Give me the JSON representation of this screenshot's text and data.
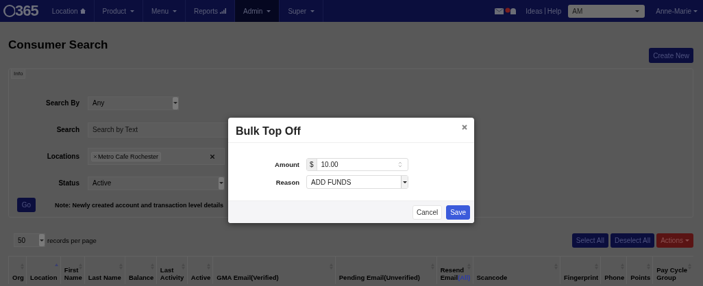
{
  "navbar": {
    "logo": "365",
    "items": [
      {
        "label": "Location",
        "kind": "home",
        "selected": false
      },
      {
        "label": "Product",
        "kind": "dropdown",
        "selected": false
      },
      {
        "label": "Menu",
        "kind": "dropdown",
        "selected": false
      },
      {
        "label": "Reports",
        "kind": "signal",
        "selected": false
      },
      {
        "label": "Admin",
        "kind": "dropdown",
        "selected": true
      },
      {
        "label": "Super",
        "kind": "dropdown",
        "selected": false
      }
    ],
    "links": [
      "Ideas",
      "Help"
    ],
    "org_select": {
      "value": "AM"
    },
    "user": "Anne-Marie"
  },
  "page": {
    "title": "Consumer Search",
    "create_button": "Create New"
  },
  "info_panel": {
    "legend": "Info",
    "fields": [
      {
        "kind": "select",
        "label": "Search By",
        "value": "Any"
      },
      {
        "kind": "text",
        "label": "Search",
        "placeholder": "Search by Text"
      },
      {
        "kind": "tags",
        "label": "Locations",
        "tags": [
          "Metro Cafe Rochester"
        ]
      },
      {
        "kind": "select",
        "label": "Status",
        "value": "Active"
      }
    ],
    "go_button": "Go",
    "note": "Note: Newly created account and transaction level details"
  },
  "table_controls": {
    "page_size": "50",
    "page_size_label": "records per page",
    "buttons": [
      {
        "label": "Select All",
        "kind": "primary"
      },
      {
        "label": "Deselect All",
        "kind": "primary"
      },
      {
        "label": "Actions",
        "kind": "danger"
      }
    ]
  },
  "table": {
    "columns": [
      {
        "label": "Org",
        "sorted": false
      },
      {
        "label": "Location",
        "sorted": true
      },
      {
        "label": "First Name",
        "sorted": false
      },
      {
        "label": "Last Name",
        "sorted": false
      },
      {
        "label": "Balance",
        "sorted": false
      },
      {
        "label": "Last Activity",
        "sorted": false
      },
      {
        "label": "Active",
        "sorted": false
      },
      {
        "label": "GMA Email(Verified)",
        "sorted": false
      },
      {
        "label": "Pending Email(Unverified)",
        "sorted": false
      },
      {
        "label": "Resend Email",
        "link": "(All)",
        "sorted": false
      },
      {
        "label": "Scancode",
        "sorted": false
      },
      {
        "label": "Fingerprint",
        "sorted": false
      },
      {
        "label": "Phone",
        "sorted": false
      },
      {
        "label": "Points",
        "sorted": false
      },
      {
        "label": "Pay Cycle Group",
        "sorted": false
      }
    ]
  },
  "modal": {
    "title": "Bulk Top Off",
    "fields": [
      {
        "kind": "number",
        "label": "Amount",
        "prefix": "$",
        "value": "10.00"
      },
      {
        "kind": "select",
        "label": "Reason",
        "value": "ADD FUNDS"
      }
    ],
    "buttons": [
      {
        "label": "Cancel",
        "kind": "default"
      },
      {
        "label": "Save",
        "kind": "primary"
      }
    ]
  }
}
